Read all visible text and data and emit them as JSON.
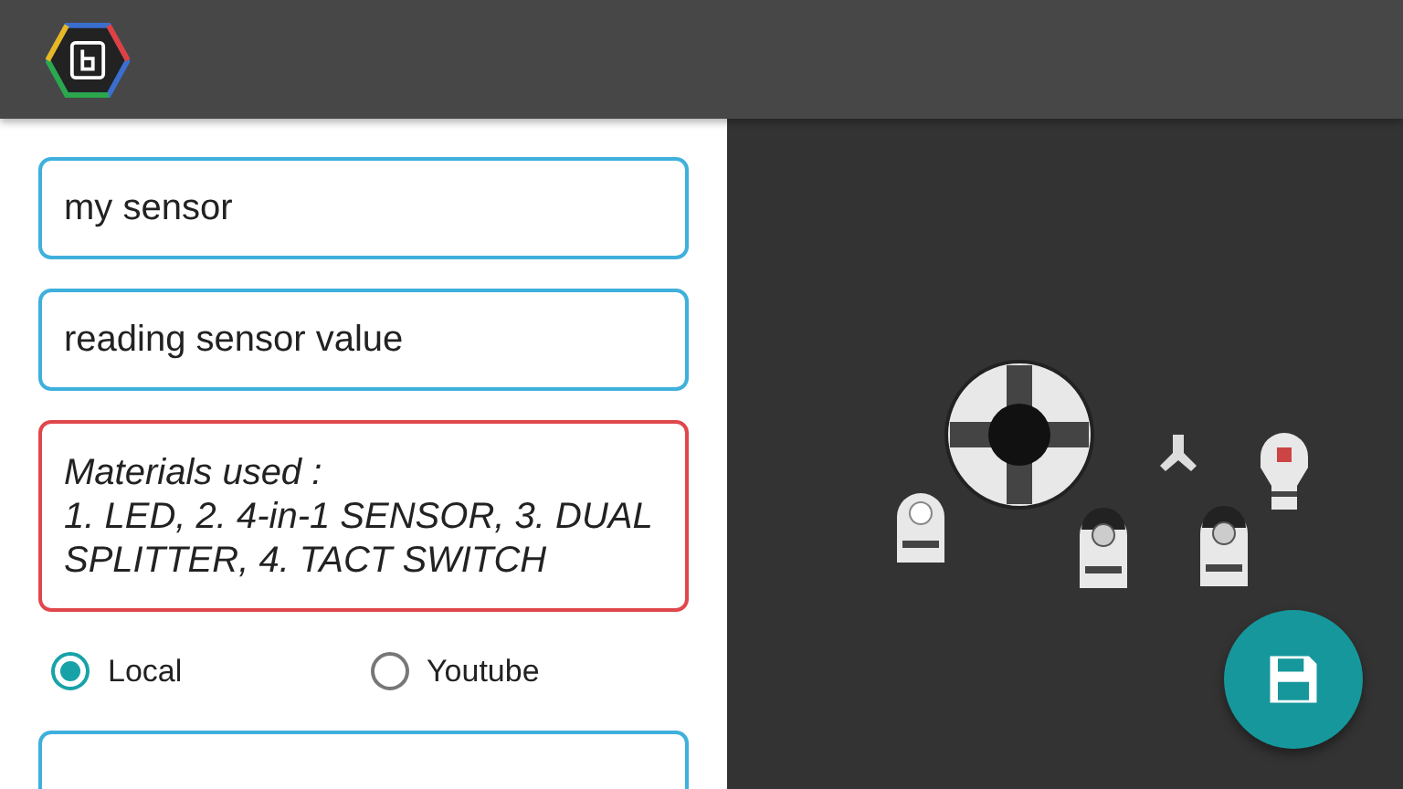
{
  "fields": [
    {
      "kind": "input",
      "value": "my sensor",
      "error": false
    },
    {
      "kind": "input",
      "value": "reading sensor value",
      "error": false
    },
    {
      "kind": "textarea",
      "lines": [
        "Materials used :",
        "1. LED, 2. 4-in-1 SENSOR, 3. DUAL SPLITTER, 4. TACT SWITCH"
      ],
      "error": true
    }
  ],
  "source_options": [
    {
      "label": "Local",
      "selected": true
    },
    {
      "label": "Youtube",
      "selected": false
    }
  ],
  "more_fields": [
    {
      "kind": "input",
      "error": false
    }
  ]
}
